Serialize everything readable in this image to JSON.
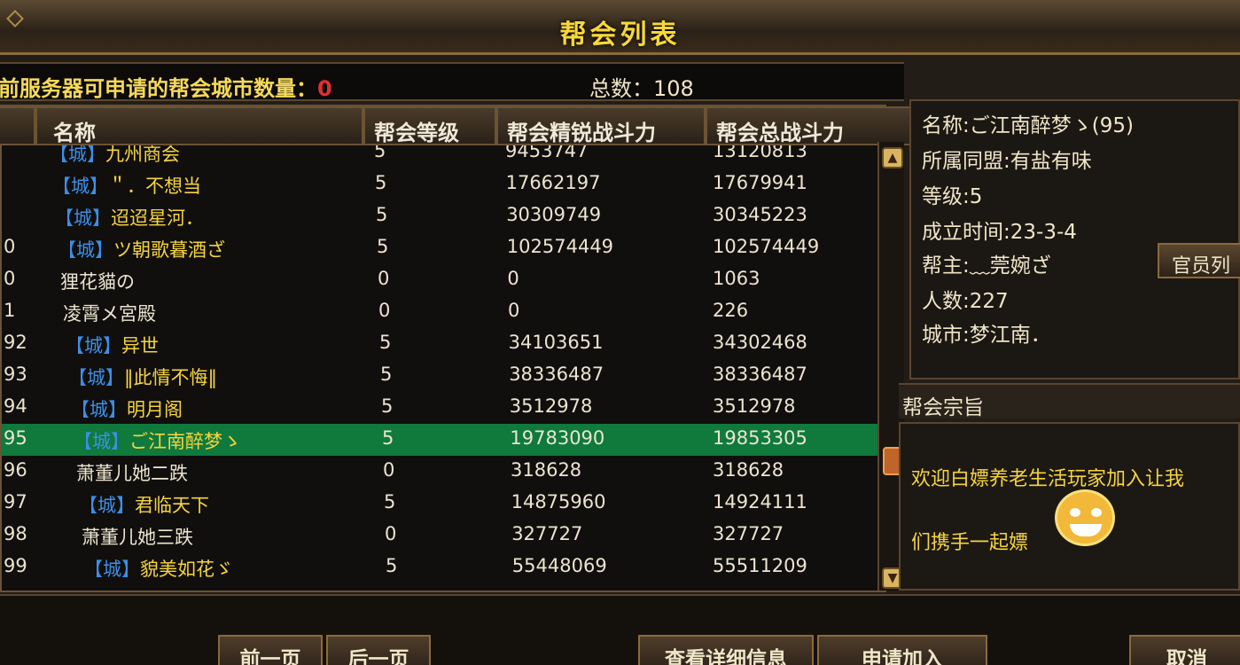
{
  "window": {
    "title": "帮会列表"
  },
  "info": {
    "city_label": "前服务器可申请的帮会城市数量：",
    "city_count": "0",
    "total_label": "总数：108"
  },
  "columns": {
    "name": "名称",
    "level": "帮会等级",
    "elite": "帮会精锐战斗力",
    "total": "帮会总战斗力"
  },
  "rows": [
    {
      "no": "",
      "tag": "【城】",
      "name": "九州商会",
      "level": "5",
      "elite": "9453747",
      "total": "13120813",
      "city": true
    },
    {
      "no": "",
      "tag": "【城】",
      "name": "＂．不想当",
      "level": "5",
      "elite": "17662197",
      "total": "17679941",
      "city": true
    },
    {
      "no": "",
      "tag": "【城】",
      "name": "迢迢星河．",
      "level": "5",
      "elite": "30309749",
      "total": "30345223",
      "city": true
    },
    {
      "no": "0",
      "tag": "【城】",
      "name": "ツ朝歌暮酒ざ",
      "level": "5",
      "elite": "102574449",
      "total": "102574449",
      "city": true
    },
    {
      "no": "0",
      "tag": "",
      "name": "狸花貓の",
      "level": "0",
      "elite": "0",
      "total": "1063",
      "city": false
    },
    {
      "no": "1",
      "tag": "",
      "name": "凌霄メ宮殿",
      "level": "0",
      "elite": "0",
      "total": "226",
      "city": false
    },
    {
      "no": "92",
      "tag": "【城】",
      "name": "异世",
      "level": "5",
      "elite": "34103651",
      "total": "34302468",
      "city": true
    },
    {
      "no": "93",
      "tag": "【城】",
      "name": "‖此情不悔‖",
      "level": "5",
      "elite": "38336487",
      "total": "38336487",
      "city": true
    },
    {
      "no": "94",
      "tag": "【城】",
      "name": "明月阁",
      "level": "5",
      "elite": "3512978",
      "total": "3512978",
      "city": true
    },
    {
      "no": "95",
      "tag": "【城】",
      "name": "ご江南醉梦ゝ",
      "level": "5",
      "elite": "19783090",
      "total": "19853305",
      "city": true,
      "selected": true
    },
    {
      "no": "96",
      "tag": "",
      "name": "萧董儿她二跌",
      "level": "0",
      "elite": "318628",
      "total": "318628",
      "city": false
    },
    {
      "no": "97",
      "tag": "【城】",
      "name": "君临天下",
      "level": "5",
      "elite": "14875960",
      "total": "14924111",
      "city": true
    },
    {
      "no": "98",
      "tag": "",
      "name": "萧董儿她三跌",
      "level": "0",
      "elite": "327727",
      "total": "327727",
      "city": false
    },
    {
      "no": "99",
      "tag": "【城】",
      "name": "貌美如花ゞ",
      "level": "5",
      "elite": "55448069",
      "total": "55511209",
      "city": true
    }
  ],
  "detail": {
    "name": "名称:ご江南醉梦ゝ(95)",
    "alliance": "所属同盟:有盐有味",
    "level": "等级:5",
    "founded": "成立时间:23-3-4",
    "leader": "帮主:﹏莞婉ざ",
    "members": "人数:227",
    "city": "城市:梦江南．",
    "officers_btn": "官员列"
  },
  "purpose": {
    "header": "帮会宗旨",
    "line1": "欢迎白嫖养老生活玩家加入让我",
    "line2": "们携手一起嫖"
  },
  "footer": {
    "prev": "前一页",
    "next": "后一页",
    "details": "查看详细信息",
    "apply": "申请加入",
    "cancel": "取消"
  }
}
